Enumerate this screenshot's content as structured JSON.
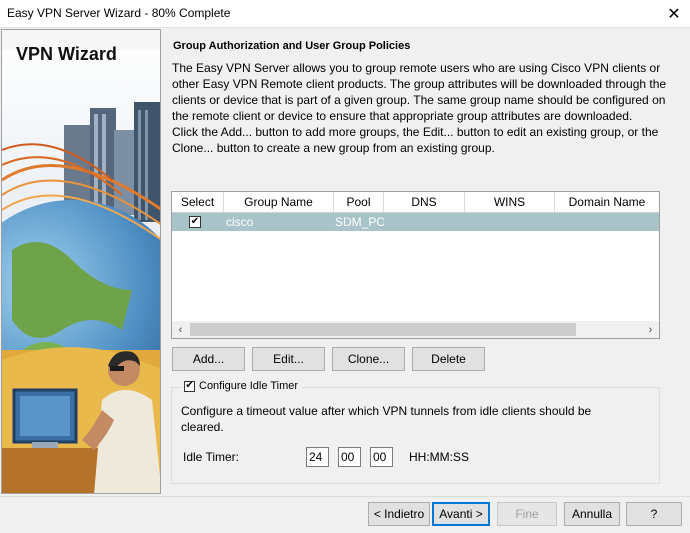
{
  "window": {
    "title": "Easy VPN Server Wizard - 80% Complete",
    "close_glyph": "✕"
  },
  "side_panel": {
    "title": "VPN Wizard"
  },
  "main": {
    "heading": "Group Authorization and User Group Policies",
    "description": [
      "The Easy VPN Server allows you to group remote users who are using Cisco VPN clients or",
      "other Easy VPN Remote client products. The group attributes will be downloaded through the",
      "clients or device that is part of a given group. The same group name should be configured on",
      "the remote client or device to ensure that appropriate group attributes are downloaded.",
      "Click the Add... button to add more groups, the Edit... button to edit an existing group, or the",
      "Clone... button to create a new group from an existing group."
    ]
  },
  "table": {
    "columns": [
      "Select",
      "Group Name",
      "Pool",
      "DNS",
      "WINS",
      "Domain Name"
    ],
    "rows": [
      {
        "selected": true,
        "group_name": "cisco",
        "pool": "SDM_PO",
        "dns": "",
        "wins": "",
        "domain_name": ""
      }
    ],
    "selected_row_color": "#a9c4c9",
    "scroll_left_glyph": "‹",
    "scroll_right_glyph": "›"
  },
  "actions": {
    "add": "Add...",
    "edit": "Edit...",
    "clone": "Clone...",
    "delete": "Delete"
  },
  "idle_timer": {
    "enabled_label": "Configure Idle Timer",
    "enabled": true,
    "help_line1": "Configure a timeout value after which VPN tunnels from idle clients should be",
    "help_line2": "cleared.",
    "label": "Idle Timer:",
    "hours": "24",
    "minutes": "00",
    "seconds": "00",
    "format": "HH:MM:SS"
  },
  "footer": {
    "back": "< Indietro",
    "next": "Avanti >",
    "finish": "Fine",
    "cancel": "Annulla",
    "help": "?"
  },
  "icons": {
    "checkbox": "checkbox-checked-icon",
    "close": "close-icon"
  }
}
